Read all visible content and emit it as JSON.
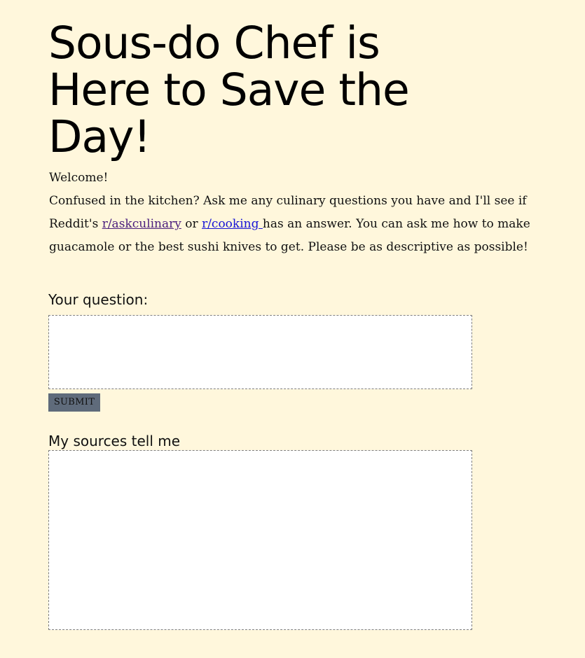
{
  "header": {
    "title": "Sous-do Chef is Here to Save the Day!"
  },
  "intro": {
    "welcome": "Welcome!",
    "text_before_link1": "Confused in the kitchen? Ask me any culinary questions you have and I'll see if Reddit's ",
    "link1": "r/askculinary",
    "text_between_links": " or ",
    "link2": "r/cooking ",
    "text_after_link2": "has an answer. You can ask me how to make guacamole or the best sushi knives to get. Please be as descriptive as possible!"
  },
  "question_form": {
    "label": "Your question:",
    "value": "",
    "submit_label": "SUBMIT"
  },
  "sources": {
    "label": "My sources tell me",
    "value": ""
  },
  "colors": {
    "background": "#fff7dc",
    "link": "#1714d6",
    "visited_link": "#4a1e7d",
    "button": "#5f6b7b"
  }
}
